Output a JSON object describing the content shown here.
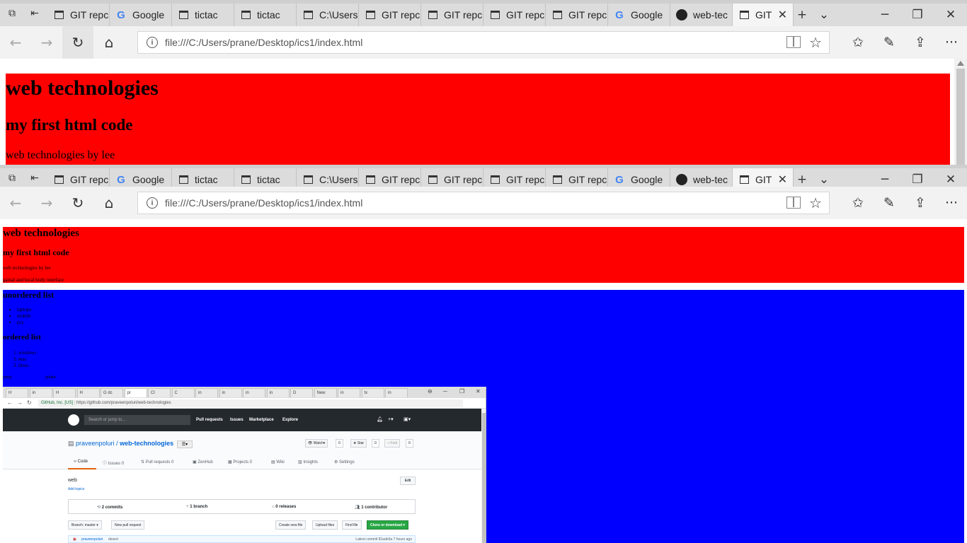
{
  "browser": {
    "tabs": [
      {
        "label": "GIT repc",
        "icon": "page-icon"
      },
      {
        "label": "Google",
        "icon": "google-icon"
      },
      {
        "label": "tictac",
        "icon": "page-icon"
      },
      {
        "label": "tictac",
        "icon": "page-icon"
      },
      {
        "label": "C:\\Users",
        "icon": "page-icon"
      },
      {
        "label": "GIT repc",
        "icon": "page-icon"
      },
      {
        "label": "GIT repc",
        "icon": "page-icon"
      },
      {
        "label": "GIT repc",
        "icon": "page-icon"
      },
      {
        "label": "GIT repc",
        "icon": "page-icon"
      },
      {
        "label": "Google",
        "icon": "google-icon"
      },
      {
        "label": "web-tec",
        "icon": "github-icon"
      },
      {
        "label": "GIT",
        "icon": "page-icon",
        "active": true
      }
    ],
    "address": "file:///C:/Users/prane/Desktop/ics1/index.html",
    "window_controls": {
      "minimize": "─",
      "restore": "❐",
      "close": "✕"
    },
    "new_tab": "+",
    "tab_list": "⌄"
  },
  "page": {
    "heading": "web technologies",
    "subheading": "my first html code",
    "byline": "web technologies by lee",
    "interface_line": "gainal and local body interface",
    "unordered_heading": "unordered list",
    "unordered_items": [
      "laptops",
      "mobile",
      "pcs"
    ],
    "ordered_heading": "ordered list",
    "ordered_items": [
      "windows",
      "mac",
      "linux"
    ],
    "bottom_left": "jump",
    "bottom_right": "jaiden",
    "colors": {
      "header_bg": "#ff0000",
      "list_bg": "#0000ff"
    }
  },
  "screenshot": {
    "chrome_tabs": [
      "H",
      "in",
      "H",
      "H",
      "G dc",
      "pr",
      "Cl",
      "C",
      "in",
      "in",
      "in",
      "in",
      "D",
      "New",
      "in",
      "tx",
      "in"
    ],
    "secure_label": "GitHub, Inc. [US]",
    "url": "https://github.com/praveenpoluri/web-technologies",
    "search_placeholder": "Search or jump to...",
    "nav_links": [
      "Pull requests",
      "Issues",
      "Marketplace",
      "Explore"
    ],
    "owner": "praveenpoluri",
    "repo": "web-technologies",
    "watch": "Watch",
    "watch_count": "0",
    "star": "Star",
    "star_count": "0",
    "fork": "Fork",
    "fork_count": "0",
    "repo_tabs": [
      {
        "label": "Code"
      },
      {
        "label": "Issues 0"
      },
      {
        "label": "Pull requests 0"
      },
      {
        "label": "ZenHub"
      },
      {
        "label": "Projects 0"
      },
      {
        "label": "Wiki"
      },
      {
        "label": "Insights"
      },
      {
        "label": "Settings"
      }
    ],
    "description": "web",
    "add_topics": "Add topics",
    "edit": "Edit",
    "commits": "2 commits",
    "branches": "1 branch",
    "releases": "0 releases",
    "contributors": "1 contributor",
    "branch_button": "Branch: master",
    "new_pr": "New pull request",
    "create_file": "Create new file",
    "upload_files": "Upload files",
    "find_file": "Find file",
    "clone": "Clone or download",
    "commit_author": "praveenpoluri",
    "commit_msg": "desert",
    "latest_commit": "Latest commit 81ade5a 7 hours ago"
  }
}
